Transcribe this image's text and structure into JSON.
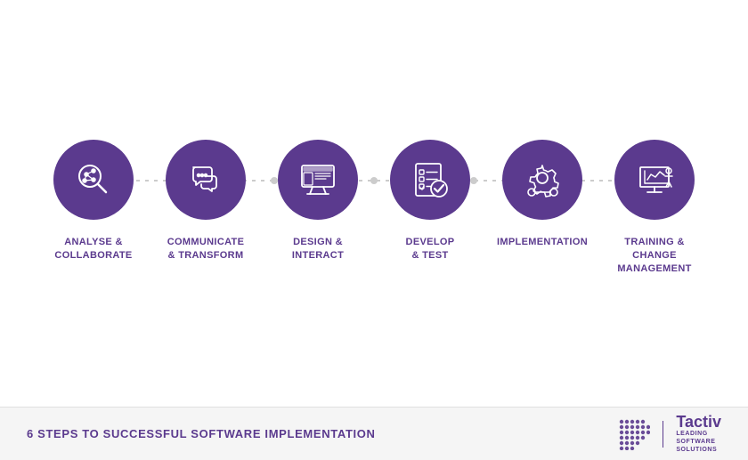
{
  "page": {
    "background": "#ffffff"
  },
  "steps": [
    {
      "id": "analyse",
      "label": "ANALYSE &\nCOLLABORATE",
      "icon": "analyse"
    },
    {
      "id": "communicate",
      "label": "COMMUNICATE\n& TRANSFORM",
      "icon": "communicate"
    },
    {
      "id": "design",
      "label": "DESIGN &\nINTERACT",
      "icon": "design"
    },
    {
      "id": "develop",
      "label": "DEVELOP\n& TEST",
      "icon": "develop"
    },
    {
      "id": "implementation",
      "label": "IMPLEMENTATION",
      "icon": "implementation"
    },
    {
      "id": "training",
      "label": "TRAINING &\nCHANGE\nMANAGEMENT",
      "icon": "training"
    }
  ],
  "footer": {
    "title": "6 STEPS TO SUCCESSFUL SOFTWARE IMPLEMENTATION",
    "logo_brand": "Tactiv",
    "logo_sub_line1": "LEADING",
    "logo_sub_line2": "SOFTWARE",
    "logo_sub_line3": "SOLUTIONS"
  }
}
